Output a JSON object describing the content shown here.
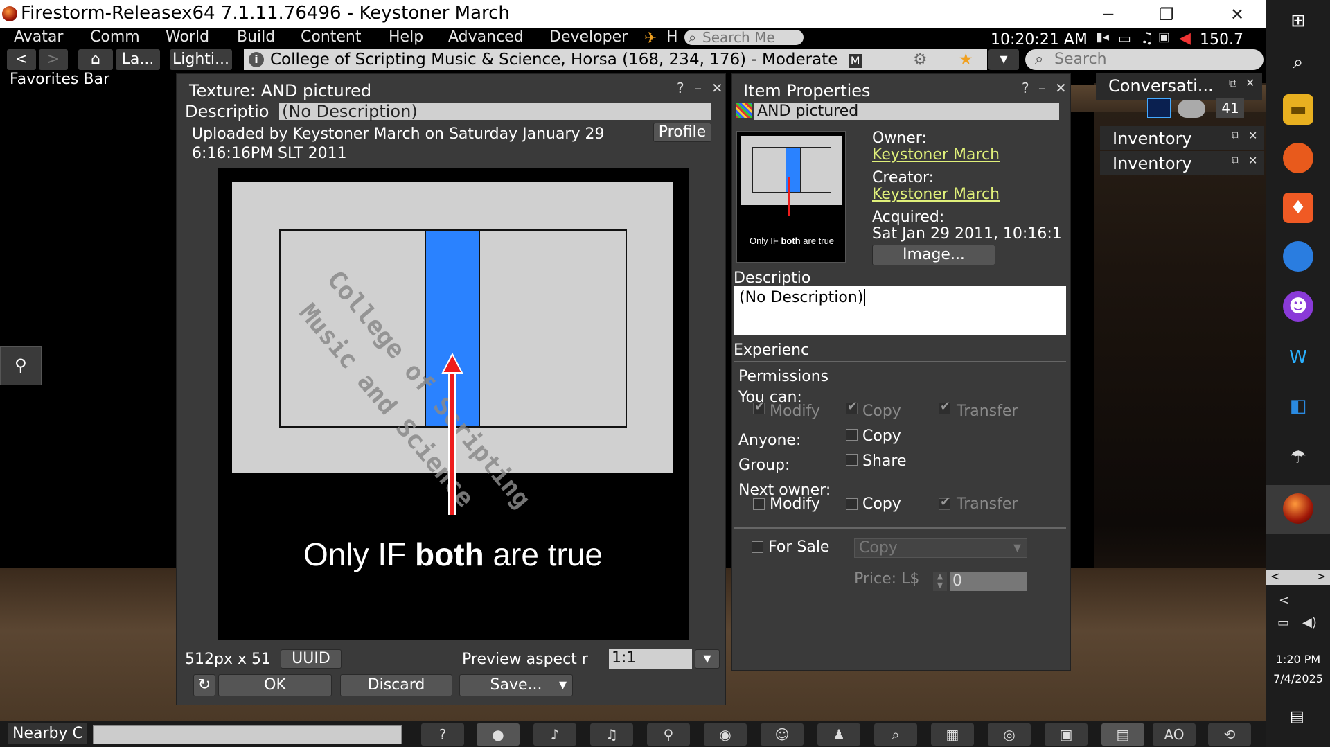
{
  "window": {
    "title": "Firestorm-Releasex64 7.1.11.76496 - Keystoner March",
    "minimize_glyph": "─",
    "maximize_glyph": "❐",
    "close_glyph": "✕"
  },
  "menubar": {
    "items": [
      "Avatar",
      "Comm",
      "World",
      "Build",
      "Content",
      "Help",
      "Advanced",
      "Developer"
    ],
    "h_label": "H",
    "search_placeholder": "Search Me",
    "clock": "10:20:21 AM",
    "fps": "150.7"
  },
  "navbar": {
    "back": "<",
    "forward": ">",
    "landmarks": "La...",
    "lighting": "Lighti...",
    "location": "College of Scripting Music & Science, Horsa (168, 234, 176) - Moderate",
    "maturity_badge": "M",
    "search_placeholder": "Search"
  },
  "favorites_bar": "Favorites Bar",
  "texture_preview": {
    "title": "Texture: AND pictured",
    "help": "?",
    "minimize": "–",
    "close": "✕",
    "description_label": "Descriptio",
    "description_value": "(No Description)",
    "uploaded_line1": "Uploaded by Keystoner March on Saturday January 29",
    "uploaded_line2": "6:16:16PM SLT 2011",
    "profile_button": "Profile",
    "image_caption_prefix": "Only IF ",
    "image_caption_bold": "both",
    "image_caption_suffix": " are true",
    "watermark_line1": "College of Scripting",
    "watermark_line2": "Music and Science",
    "dimensions": "512px x 51",
    "uuid_button": "UUID",
    "preview_aspect_label": "Preview aspect r",
    "preview_aspect_value": "1:1",
    "ok_button": "OK",
    "discard_button": "Discard",
    "save_button": "Save..."
  },
  "item_properties": {
    "title": "Item Properties",
    "help": "?",
    "minimize": "–",
    "close": "✕",
    "name": "AND pictured",
    "owner_label": "Owner:",
    "owner": "Keystoner March",
    "creator_label": "Creator:",
    "creator": "Keystoner March",
    "acquired_label": "Acquired:",
    "acquired": "Sat Jan 29 2011, 10:16:1",
    "image_button": "Image...",
    "thumb_caption_prefix": "Only IF ",
    "thumb_caption_bold": "both",
    "thumb_caption_suffix": " are true",
    "description_label": "Descriptio",
    "description_value": "(No Description)",
    "experience_label": "Experienc",
    "permissions_label": "Permissions",
    "you_can_label": "You can:",
    "you_modify": "Modify",
    "you_copy": "Copy",
    "you_transfer": "Transfer",
    "anyone_label": "Anyone:",
    "anyone_copy": "Copy",
    "group_label": "Group:",
    "group_share": "Share",
    "next_owner_label": "Next owner:",
    "next_modify": "Modify",
    "next_copy": "Copy",
    "next_transfer": "Transfer",
    "for_sale_label": "For Sale",
    "sale_type": "Copy",
    "price_label": "Price: L$",
    "price_value": "0"
  },
  "side_panels": {
    "conversations": "Conversati...",
    "conversations_count": "41",
    "inventory1": "Inventory",
    "inventory2": "Inventory",
    "float_glyph": "⧉",
    "close_glyph": "✕"
  },
  "bottom_bar": {
    "nearby_chat": "Nearby C",
    "ao_label": "AO"
  },
  "taskbar": {
    "time": "1:20 PM",
    "date": "7/4/2025"
  }
}
